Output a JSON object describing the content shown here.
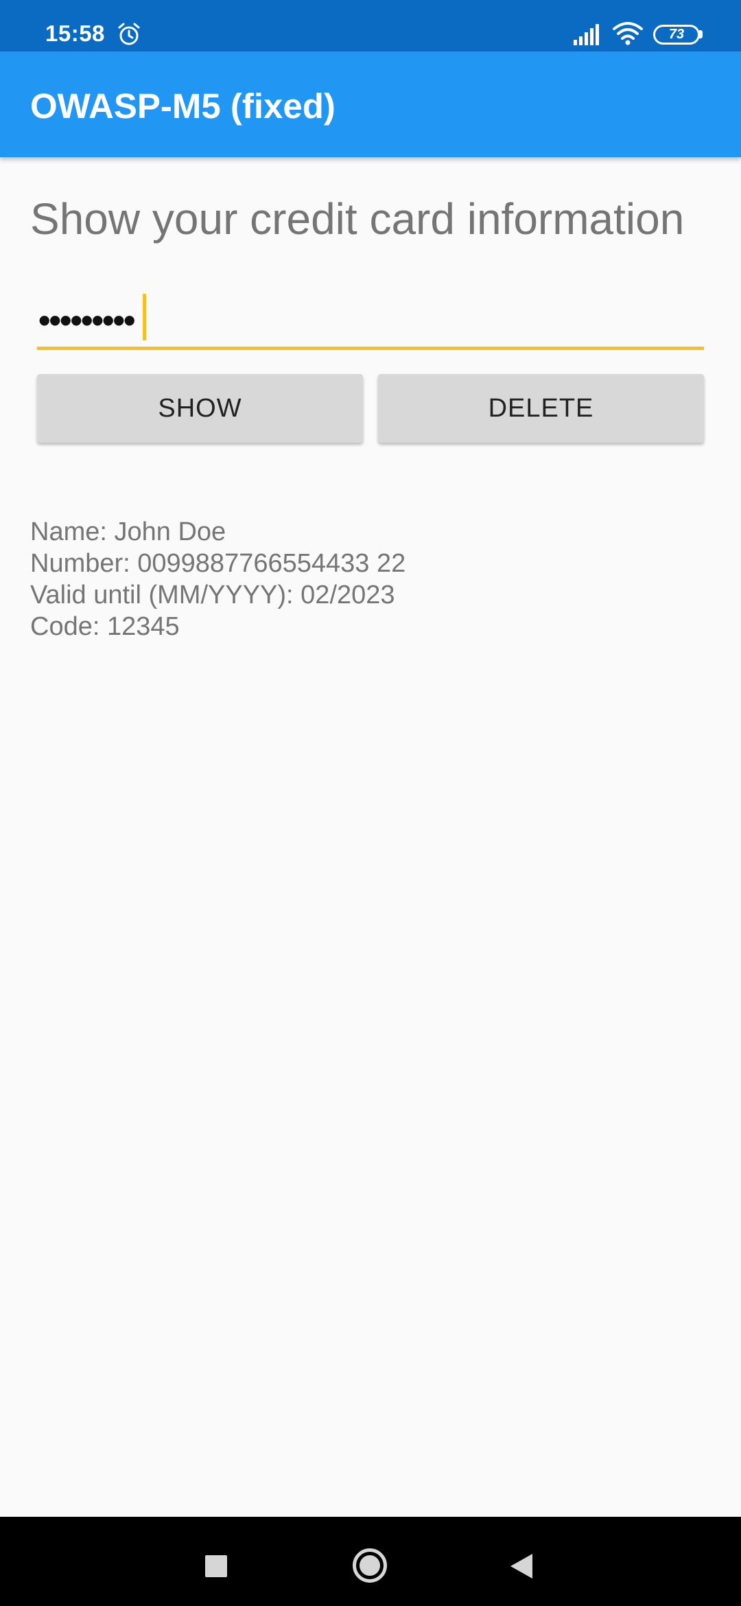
{
  "status_bar": {
    "time": "15:58",
    "battery_level": "73",
    "icons": [
      "alarm-icon",
      "signal-icon",
      "wifi-icon",
      "battery-icon"
    ]
  },
  "app_bar": {
    "title": "OWASP-M5 (fixed)",
    "color": "#2196f3"
  },
  "main": {
    "heading": "Show your credit card information",
    "pin_input": {
      "value": "•••••••••",
      "accent_color": "#f5c02a"
    },
    "buttons": {
      "show_label": "SHOW",
      "delete_label": "DELETE"
    },
    "card_info": {
      "name": "Name: John Doe",
      "number": "Number: 0099887766554433 22",
      "valid_until": "Valid until (MM/YYYY): 02/2023",
      "code": "Code: 12345"
    }
  },
  "nav_bar": {
    "icons": [
      "recents-icon",
      "home-icon",
      "back-icon"
    ]
  }
}
